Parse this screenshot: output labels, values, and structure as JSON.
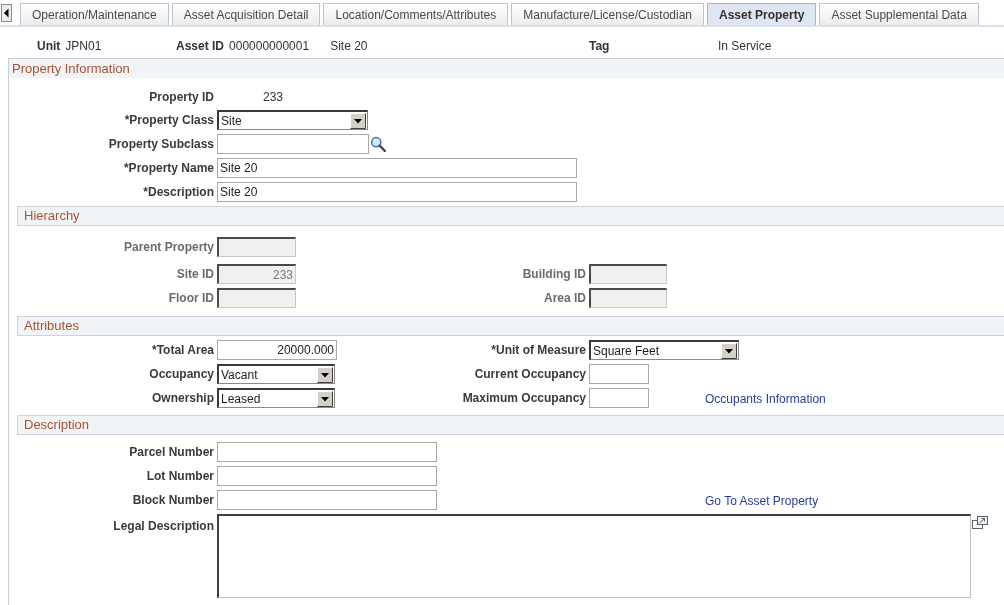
{
  "tabs": [
    {
      "label": "Operation/Maintenance",
      "selected": false
    },
    {
      "label": "Asset Acquisition Detail",
      "selected": false
    },
    {
      "label": "Location/Comments/Attributes",
      "selected": false
    },
    {
      "label": "Manufacture/License/Custodian",
      "selected": false
    },
    {
      "label": "Asset Property",
      "selected": true
    },
    {
      "label": "Asset Supplemental Data",
      "selected": false
    }
  ],
  "header": {
    "unit": {
      "label": "Unit",
      "value": "JPN01"
    },
    "asset": {
      "label": "Asset ID",
      "value": "000000000001",
      "description": "Site 20"
    },
    "tag": {
      "label": "Tag"
    },
    "status": "In Service"
  },
  "property_information": {
    "title": "Property Information",
    "rows": [
      {
        "left": {
          "kind": "display",
          "label": "Property ID",
          "value": "233"
        }
      },
      {
        "left": {
          "kind": "select",
          "label": "*Property Class",
          "value": "Site"
        }
      },
      {
        "left": {
          "kind": "lookup",
          "label": "Property Subclass"
        }
      },
      {
        "left": {
          "kind": "text",
          "label": "*Property Name",
          "value": "Site 20"
        }
      },
      {
        "left": {
          "kind": "text",
          "label": "*Description",
          "value": "Site 20"
        }
      }
    ],
    "sections": [
      {
        "title": "Hierarchy",
        "rows": [
          {
            "left": {
              "kind": "text",
              "label": "Parent Property",
              "disabled": true
            }
          },
          {
            "left": {
              "kind": "number",
              "label": "Site ID",
              "value": "233",
              "disabled": true
            },
            "right": {
              "kind": "text",
              "label": "Building ID",
              "disabled": true
            }
          },
          {
            "left": {
              "kind": "text",
              "label": "Floor ID",
              "disabled": true
            },
            "right": {
              "kind": "text",
              "label": "Area ID",
              "disabled": true
            }
          }
        ]
      },
      {
        "title": "Attributes",
        "rows": [
          {
            "left": {
              "kind": "number",
              "label": "*Total Area",
              "value": "20000.000"
            },
            "right": {
              "kind": "select",
              "label": "*Unit of Measure",
              "value": "Square Feet"
            }
          },
          {
            "left": {
              "kind": "select",
              "label": "Occupancy",
              "value": "Vacant"
            },
            "right": {
              "kind": "text",
              "label": "Current Occupancy"
            }
          },
          {
            "left": {
              "kind": "select",
              "label": "Ownership",
              "value": "Leased"
            },
            "right": {
              "kind": "text",
              "label": "Maximum Occupancy"
            },
            "link": "Occupants Information"
          }
        ]
      },
      {
        "title": "Description",
        "rows": [
          {
            "left": {
              "kind": "text",
              "label": "Parcel Number"
            }
          },
          {
            "left": {
              "kind": "text",
              "label": "Lot Number"
            }
          },
          {
            "left": {
              "kind": "text",
              "label": "Block Number"
            },
            "link": "Go To Asset Property"
          },
          {
            "left": {
              "kind": "textarea",
              "label": "Legal Description"
            }
          }
        ]
      }
    ]
  }
}
